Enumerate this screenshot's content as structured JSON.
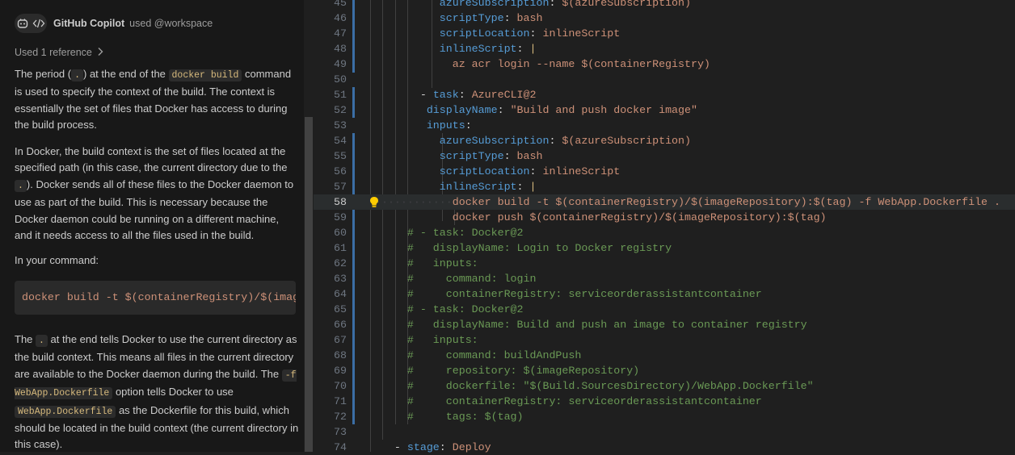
{
  "chat": {
    "title": "GitHub Copilot",
    "subtitle": "used @workspace",
    "used_ref": "Used 1 reference",
    "p1": {
      "a": "The period (",
      "c1": ".",
      "b": ") at the end of the ",
      "c2": "docker build",
      "d": " command is used to specify the context of the build. The context is essentially the set of files that Docker has access to during the build process."
    },
    "p2": {
      "a": "In Docker, the build context is the set of files located at the specified path (in this case, the current directory due to the ",
      "c1": ".",
      "b": "). Docker sends all of these files to the Docker daemon to use as part of the build. This is necessary because the Docker daemon could be running on a different machine, and it needs access to all the files used in the build."
    },
    "p3": "In your command:",
    "code_block": "docker build -t $(containerRegistry)/$(imageRepository):$(tag) -f WebApp.Dockerfile .",
    "p4": {
      "a": "The ",
      "c1": ".",
      "b": " at the end tells Docker to use the current directory as the build context. This means all files in the current directory are available to the Docker daemon during the build. The ",
      "c2": "-f WebApp.Dockerfile",
      "d": " option tells Docker to use ",
      "c3": "WebApp.Dockerfile",
      "e": " as the Dockerfile for this build, which should be located in the build context (the current directory in this case)."
    }
  },
  "editor": {
    "current_line": 58,
    "lines": [
      {
        "n": "45",
        "code": "azureSubscription: $(azureSubscription)"
      },
      {
        "n": "46",
        "code": "scriptType: bash"
      },
      {
        "n": "47",
        "code": "scriptLocation: inlineScript"
      },
      {
        "n": "48",
        "code": "inlineScript: |"
      },
      {
        "n": "49",
        "code": "az acr login --name $(containerRegistry)"
      },
      {
        "n": "50",
        "code": ""
      },
      {
        "n": "51",
        "code": "- task: AzureCLI@2"
      },
      {
        "n": "52",
        "code": "displayName: \"Build and push docker image\""
      },
      {
        "n": "53",
        "code": "inputs:"
      },
      {
        "n": "54",
        "code": "azureSubscription: $(azureSubscription)"
      },
      {
        "n": "55",
        "code": "scriptType: bash"
      },
      {
        "n": "56",
        "code": "scriptLocation: inlineScript"
      },
      {
        "n": "57",
        "code": "inlineScript: |"
      },
      {
        "n": "58",
        "code": "docker build -t $(containerRegistry)/$(imageRepository):$(tag) -f WebApp.Dockerfile ."
      },
      {
        "n": "59",
        "code": "docker push $(containerRegistry)/$(imageRepository):$(tag)"
      },
      {
        "n": "60",
        "code": "# - task: Docker@2"
      },
      {
        "n": "61",
        "code": "#   displayName: Login to Docker registry"
      },
      {
        "n": "62",
        "code": "#   inputs:"
      },
      {
        "n": "63",
        "code": "#     command: login"
      },
      {
        "n": "64",
        "code": "#     containerRegistry: serviceorderassistantcontainer"
      },
      {
        "n": "65",
        "code": "# - task: Docker@2"
      },
      {
        "n": "66",
        "code": "#   displayName: Build and push an image to container registry"
      },
      {
        "n": "67",
        "code": "#   inputs:"
      },
      {
        "n": "68",
        "code": "#     command: buildAndPush"
      },
      {
        "n": "69",
        "code": "#     repository: $(imageRepository)"
      },
      {
        "n": "70",
        "code": "#     dockerfile: \"$(Build.SourcesDirectory)/WebApp.Dockerfile\""
      },
      {
        "n": "71",
        "code": "#     containerRegistry: serviceorderassistantcontainer"
      },
      {
        "n": "72",
        "code": "#     tags: $(tag)"
      },
      {
        "n": "73",
        "code": ""
      },
      {
        "n": "74",
        "code": "- stage: Deploy"
      }
    ]
  },
  "colors": {
    "keyword": "#569cd6",
    "string": "#ce9178",
    "comment": "#6a9955",
    "gutter_modified": "#3b6ea5"
  },
  "icons": [
    "copilot-icon",
    "code-icon",
    "chevron-right-icon",
    "lightbulb-icon"
  ]
}
